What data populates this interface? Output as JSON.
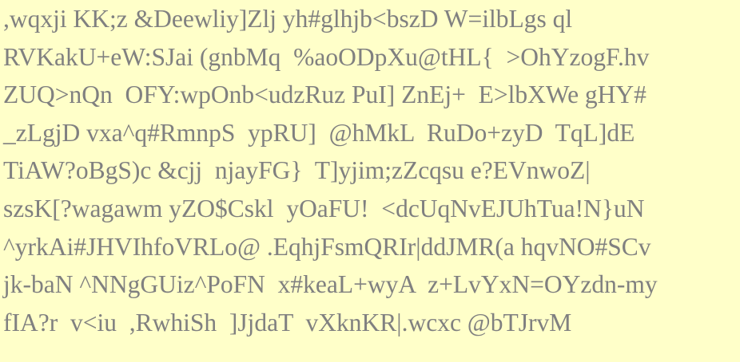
{
  "background_color": "#ffffc9",
  "text_color": "#808080",
  "lines": [
    ",wqxji KK;z &Deewliy]Zlj yh#glhjb<bszD W=ilbLgs ql",
    "RVKakU+eW:SJai (gnbMq  %aoODpXu@tHL{  >OhYzogF.hv",
    "ZUQ>nQn  OFY:wpOnb<udzRuz PuI] ZnEj+  E>lbXWe gHY#",
    "_zLgjD vxa^q#RmnpS  ypRU]  @hMkL  RuDo+zyD  TqL]dE",
    "TiAW?oBgS)c &cjj  njayFG}  T]yjim;zZcqsu e?EVnwoZ|",
    "szsK[?wagawm yZO$Cskl  yOaFU!  <dcUqNvEJUhTua!N}uN",
    "^yrkAi#JHVIhfoVRLo@ .EqhjFsmQRIr|ddJMR(a hqvNO#SCv",
    "jk-baN ^NNgGUiz^PoFN  x#keaL+wyA  z+LvYxN=OYzdn-my",
    "fIA?r  v<iu  ,RwhiSh  ]JjdaT  vXknKR|.wcxc @bTJrvM"
  ]
}
